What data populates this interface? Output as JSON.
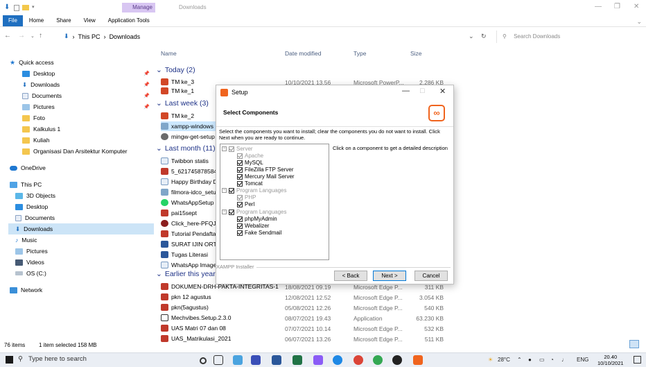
{
  "ribbon": {
    "manage_label": "Manage",
    "window_title": "Downloads",
    "tabs": [
      "File",
      "Home",
      "Share",
      "View",
      "Application Tools"
    ]
  },
  "address": {
    "path": [
      "This PC",
      "Downloads"
    ],
    "search_placeholder": "Search Downloads"
  },
  "nav": {
    "quick_access": "Quick access",
    "items": [
      "Desktop",
      "Downloads",
      "Documents",
      "Pictures",
      "Foto",
      "Kalkulus 1",
      "Kuliah",
      "Organisasi Dan Arsitektur Komputer",
      "OneDrive",
      "This PC",
      "3D Objects",
      "Desktop",
      "Documents",
      "Downloads",
      "Music",
      "Pictures",
      "Videos",
      "OS (C:)",
      "Network"
    ]
  },
  "columns": {
    "name": "Name",
    "date": "Date modified",
    "type": "Type",
    "size": "Size"
  },
  "groups": {
    "today": "Today (2)",
    "last_week": "Last week (3)",
    "last_month": "Last month (11)",
    "earlier": "Earlier this year"
  },
  "files": {
    "tm3": {
      "name": "TM ke_3",
      "date": "10/10/2021 13.56",
      "type": "Microsoft PowerP...",
      "size": "2.286 KB"
    },
    "tm1": {
      "name": "TM ke_1"
    },
    "tm2": {
      "name": "TM ke_2"
    },
    "xampp": {
      "name": "xampp-windows"
    },
    "mingw": {
      "name": "mingw-get-setup"
    },
    "twibbon": {
      "name": "Twibbon statis"
    },
    "n5": {
      "name": "5_6217458785846"
    },
    "hbd": {
      "name": "Happy Birthday D"
    },
    "filmora": {
      "name": "filmora-idco_setu"
    },
    "wa": {
      "name": "WhatsAppSetup"
    },
    "pai": {
      "name": "pai15sept"
    },
    "click": {
      "name": "Click_here-PFQJ-"
    },
    "tutorial": {
      "name": "Tutorial Pendafta"
    },
    "surat": {
      "name": "SURAT IJIN ORTU"
    },
    "tugas": {
      "name": "Tugas Literasi"
    },
    "waimg": {
      "name": "WhatsApp Image"
    },
    "dokumen": {
      "name": "DOKUMEN-DRH-PAKTA-INTEGRITAS-1",
      "date": "18/08/2021 09.19",
      "type": "Microsoft Edge P...",
      "size": "311 KB"
    },
    "pkn12": {
      "name": "pkn 12 agustus",
      "date": "12/08/2021 12.52",
      "type": "Microsoft Edge P...",
      "size": "3.054 KB"
    },
    "pkn5": {
      "name": "pkn(5agustus)",
      "date": "05/08/2021 12.26",
      "type": "Microsoft Edge P...",
      "size": "540 KB"
    },
    "mech": {
      "name": "Mechvibes.Setup.2.3.0",
      "date": "08/07/2021 19.43",
      "type": "Application",
      "size": "63.230 KB"
    },
    "uasmatri": {
      "name": "UAS Matri 07 dan 08",
      "date": "07/07/2021 10.14",
      "type": "Microsoft Edge P...",
      "size": "532 KB"
    },
    "uasmatrik": {
      "name": "UAS_Matrikulasi_2021",
      "date": "06/07/2021 13.26",
      "type": "Microsoft Edge P...",
      "size": "511 KB"
    }
  },
  "status": {
    "items": "76 items",
    "selected": "1 item selected 158 MB"
  },
  "dialog": {
    "title": "Setup",
    "header": "Select Components",
    "description": "Select the components you want to install; clear the components you do not want to install. Click Next when you are ready to continue.",
    "hint": "Click on a component to get a detailed description",
    "tree": {
      "server": "Server",
      "apache": "Apache",
      "mysql": "MySQL",
      "filezilla": "FileZilla FTP Server",
      "mercury": "Mercury Mail Server",
      "tomcat": "Tomcat",
      "prog1": "Program Languages",
      "php": "PHP",
      "perl": "Perl",
      "prog2": "Program Languages",
      "phpmyadmin": "phpMyAdmin",
      "webalizer": "Webalizer",
      "sendmail": "Fake Sendmail"
    },
    "footer_label": "XAMPP Installer",
    "back": "< Back",
    "next": "Next >",
    "cancel": "Cancel"
  },
  "taskbar": {
    "search": "Type here to search",
    "weather": "28°C",
    "lang": "ENG",
    "time": "20.40",
    "date": "10/10/2021"
  }
}
